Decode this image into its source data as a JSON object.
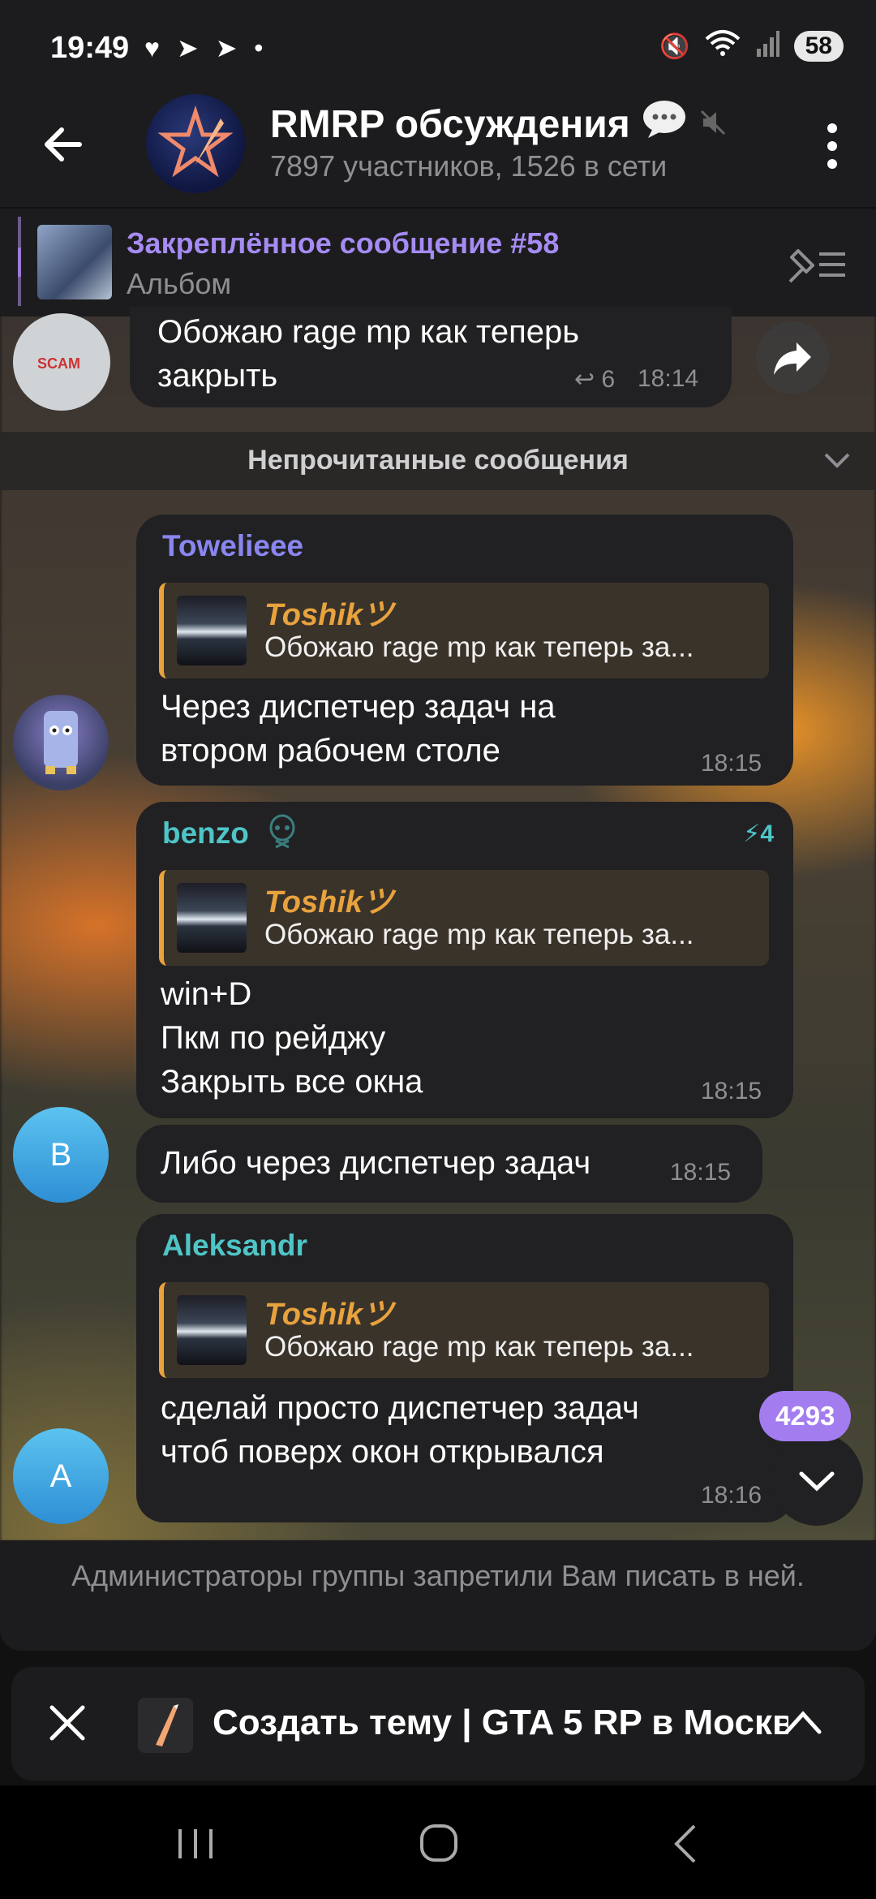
{
  "status_bar": {
    "time": "19:49",
    "battery": "58"
  },
  "header": {
    "title": "RMRP обсуждения",
    "subtitle": "7897 участников, 1526 в сети"
  },
  "pinned": {
    "title": "Закреплённое сообщение #58",
    "subtitle": "Альбом"
  },
  "top_message": {
    "text": "Обожаю rage mp как теперь\nзакрыть",
    "replies": "6",
    "time": "18:14"
  },
  "unread_divider": "Непрочитанные сообщения",
  "messages": [
    {
      "sender": "Towelieee",
      "sender_color": "#8a86f0",
      "reply_name": "Toshikツ",
      "reply_text": "Обожаю rage mp как теперь за...",
      "text": "Через диспетчер задач на\nвтором рабочем столе",
      "time": "18:15"
    },
    {
      "sender": "benzo",
      "sender_color": "#4fc5c7",
      "boosts": "4",
      "reply_name": "Toshikツ",
      "reply_text": "Обожаю rage mp как теперь за...",
      "text": "win+D\nПкм по рейджу\nЗакрыть все окна",
      "time": "18:15",
      "avatar_letter": "B"
    },
    {
      "text": "Либо через диспетчер задач",
      "time": "18:15"
    },
    {
      "sender": "Aleksandr",
      "sender_color": "#4fc5c7",
      "reply_name": "Toshikツ",
      "reply_text": "Обожаю rage mp как теперь за...",
      "text": "сделай просто диспетчер задач\nчтоб поверх окон открывался",
      "time": "18:16",
      "avatar_letter": "A"
    }
  ],
  "scroll": {
    "unread_count": "4293"
  },
  "restricted_notice": "Администраторы группы запретили Вам писать в ней.",
  "topic_bar": {
    "text": "Создать тему | GTA 5 RP в Москве"
  },
  "colors": {
    "accent": "#a37df0",
    "reply": "#e8a23e",
    "bubble": "#212123"
  }
}
